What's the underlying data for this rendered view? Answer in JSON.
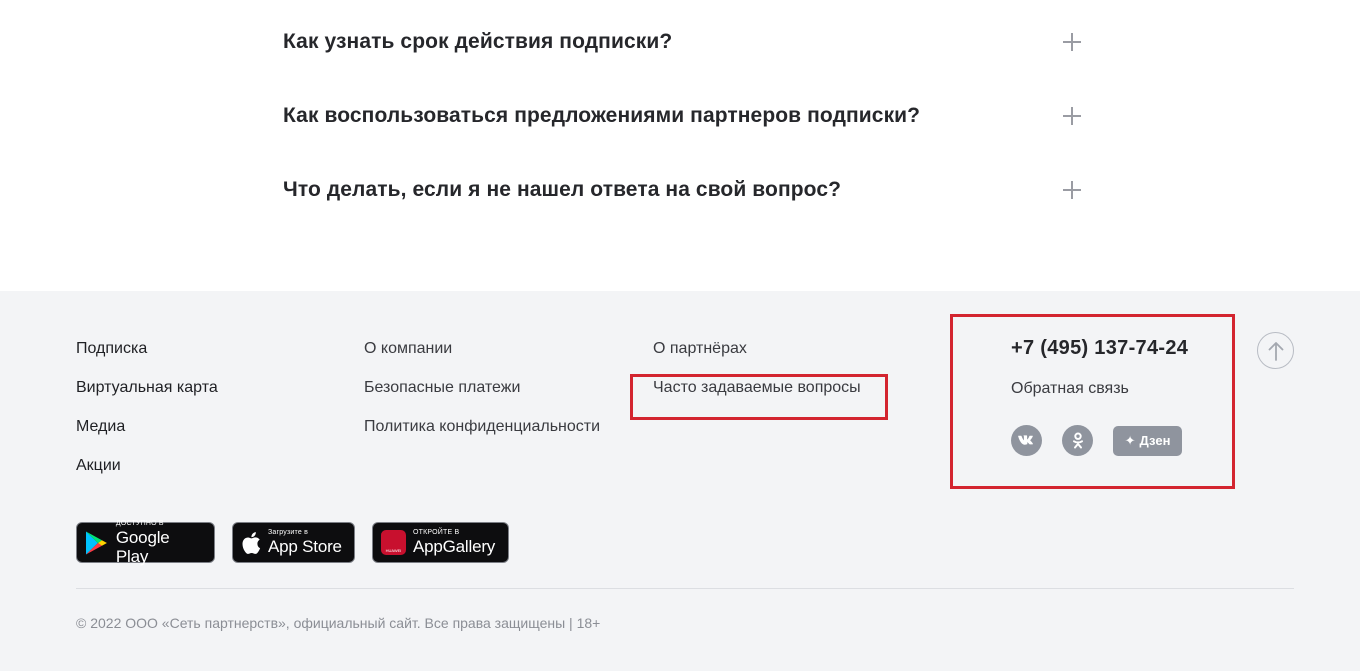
{
  "faq": {
    "items": [
      {
        "question": "Как узнать срок действия подписки?"
      },
      {
        "question": "Как воспользоваться предложениями партнеров подписки?"
      },
      {
        "question": "Что делать, если я не нашел ответа на свой вопрос?"
      }
    ]
  },
  "footer": {
    "col1": [
      "Подписка",
      "Виртуальная карта",
      "Медиа",
      "Акции"
    ],
    "col2": [
      "О компании",
      "Безопасные платежи",
      "Политика конфиденциальности"
    ],
    "col3": [
      "О партнёрах",
      "Часто задаваемые вопросы"
    ],
    "phone": "+7 (495) 137-74-24",
    "feedback": "Обратная связь",
    "socials": [
      {
        "icon": "vk-icon",
        "label": "vk"
      },
      {
        "icon": "odnoklassniki-icon",
        "label": "ok"
      }
    ],
    "dzen_label": "Дзен",
    "stores": [
      {
        "small": "ДОСТУПНО В",
        "big": "Google Play",
        "icon": "google-play-icon"
      },
      {
        "small": "Загрузите в",
        "big": "App Store",
        "icon": "apple-icon"
      },
      {
        "small": "ОТКРОЙТЕ В",
        "big": "AppGallery",
        "icon": "huawei-icon",
        "icon_text": "HUAWEI"
      }
    ],
    "copyright": "© 2022 ООО «Сеть партнерств», официальный сайт. Все права защищены | 18+"
  },
  "colors": {
    "highlight": "#d3242f",
    "footer_bg": "#f3f4f6",
    "social_bg": "#8f949e"
  }
}
